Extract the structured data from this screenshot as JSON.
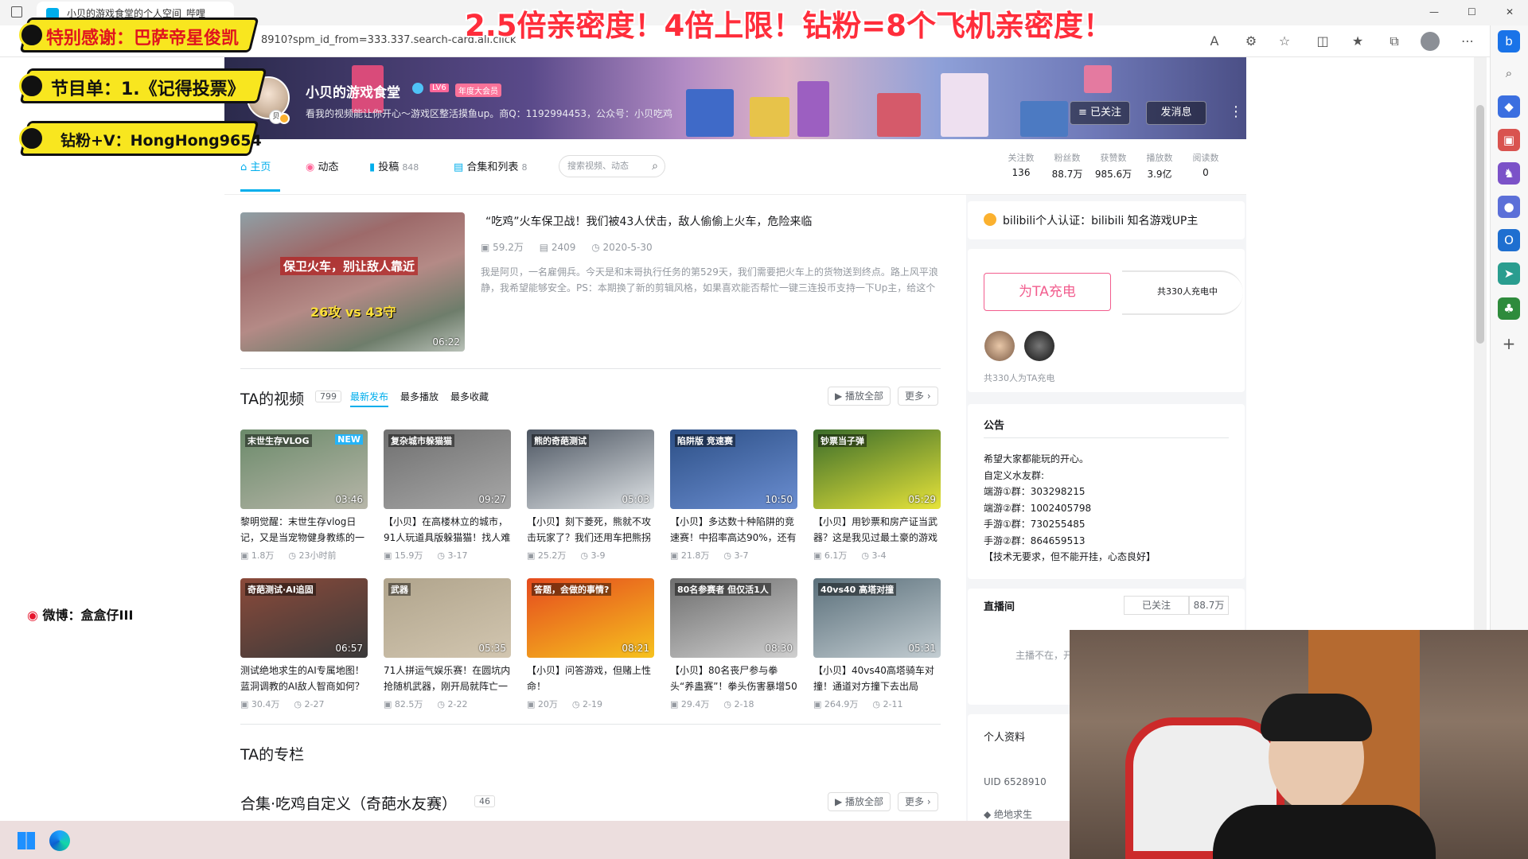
{
  "browser": {
    "tab_title": "小贝的游戏食堂的个人空间_哔哩",
    "url": "8910?spm_id_from=333.337.search-card.all.click",
    "reader_mode": "A",
    "window_min": "—",
    "window_max": "☐",
    "window_close": "✕"
  },
  "overlays": {
    "top_banner": "2.5倍亲密度！4倍上限！钻粉=8个飞机亲密度！",
    "thanks": "特别感谢：巴萨帝星俊凯",
    "playlist": "节目单：1.《记得投票》",
    "wechat": "钻粉+V：HongHong9654",
    "weibo": "微博：盒盒仔III"
  },
  "profile": {
    "name": "小贝的游戏食堂",
    "level": "LV6",
    "vip": "年度大会员",
    "sign": "看我的视频能让你开心～游戏区整活摸鱼up。商Q：1192994453，公众号：小贝吃鸡",
    "followed_label": "≡ 已关注",
    "message_label": "发消息",
    "avatar_badge": "贝"
  },
  "nav": {
    "home": "主页",
    "dynamic": "动态",
    "posts": "投稿",
    "posts_count": "848",
    "collections": "合集和列表",
    "collections_count": "8",
    "search_placeholder": "搜索视频、动态"
  },
  "stats": [
    {
      "label": "关注数",
      "value": "136"
    },
    {
      "label": "粉丝数",
      "value": "88.7万"
    },
    {
      "label": "获赞数",
      "value": "985.6万"
    },
    {
      "label": "播放数",
      "value": "3.9亿"
    },
    {
      "label": "阅读数",
      "value": "0"
    }
  ],
  "featured": {
    "title": "“吃鸡”火车保卫战！我们被43人伏击，敌人偷偷上火车，危险来临",
    "plays": "59.2万",
    "danmaku": "2409",
    "date": "2020-5-30",
    "desc": "我是阿贝，一名雇佣兵。今天是和末哥执行任务的第529天，我们需要把火车上的货物送到终点。路上风平浪静，我希望能够安全。PS：本期换了新的剪辑风格，如果喜欢能否帮忙一键三连投币支持一下Up主，给这个",
    "duration": "06:22",
    "thumb_line1": "保卫火车，别让敌人靠近",
    "thumb_line2": "26攻 vs 43守"
  },
  "videos_section": {
    "title": "TA的视频",
    "count": "799",
    "tab_latest": "最新发布",
    "tab_plays": "最多播放",
    "tab_fav": "最多收藏",
    "play_all": "▶ 播放全部",
    "more": "更多 ›"
  },
  "videos": [
    {
      "title": "黎明觉醒：末世生存vlog日记，又是当宠物健身教练的一",
      "plays": "1.8万",
      "time": "23小时前",
      "dur": "03:46",
      "thumb_text": "末世生存VLOG",
      "badge": "NEW"
    },
    {
      "title": "【小贝】在高楼林立的城市，91人玩道具版躲猫猫！找人难",
      "plays": "15.9万",
      "time": "3-17",
      "dur": "09:27",
      "thumb_text": "复杂城市躲猫猫"
    },
    {
      "title": "【小贝】刻下菱死，熊就不攻击玩家了？我们还用车把熊拐",
      "plays": "25.2万",
      "time": "3-9",
      "dur": "05:03",
      "thumb_text": "熊的奇葩测试"
    },
    {
      "title": "【小贝】多达数十种陷阱的竞速赛！中招率高达90%，还有",
      "plays": "21.8万",
      "time": "3-7",
      "dur": "10:50",
      "thumb_text": "陷阱版 竞速赛"
    },
    {
      "title": "【小贝】用钞票和房产证当武器？这是我见过最土豪的游戏",
      "plays": "6.1万",
      "time": "3-4",
      "dur": "05:29",
      "thumb_text": "钞票当子弹"
    },
    {
      "title": "测试绝地求生的AI专属地图！蓝洞调教的AI敌人智商如何？",
      "plays": "30.4万",
      "time": "2-27",
      "dur": "06:57",
      "thumb_text": "奇葩测试·AI追固"
    },
    {
      "title": "71人拼运气娱乐赛！在圆坑内抢随机武器，刚开局就阵亡一",
      "plays": "82.5万",
      "time": "2-22",
      "dur": "05:35",
      "thumb_text": "武器"
    },
    {
      "title": "【小贝】问答游戏，但赌上性命！",
      "plays": "20万",
      "time": "2-19",
      "dur": "08:21",
      "thumb_text": "答题，会做的事情?"
    },
    {
      "title": "【小贝】80名丧尸参与拳头“养蛊赛”！拳头伤害暴增50",
      "plays": "29.4万",
      "time": "2-18",
      "dur": "08:30",
      "thumb_text": "80名参赛者 但仅活1人"
    },
    {
      "title": "【小贝】40vs40高塔骑车对撞！通道对方撞下去出局",
      "plays": "264.9万",
      "time": "2-11",
      "dur": "05:31",
      "thumb_text": "40vs40 高塔对撞"
    }
  ],
  "column_section": {
    "title": "TA的专栏"
  },
  "collection_section": {
    "title": "合集·吃鸡自定义（奇葩水友赛）",
    "count": "46",
    "play_all": "▶ 播放全部",
    "more": "更多 ›"
  },
  "right": {
    "cert": "bilibili个人认证：bilibili 知名游戏UP主",
    "charge_btn": "为TA充电",
    "charge_total": "共330人充电中",
    "charge_count": "共330人为TA充电",
    "announce_title": "公告",
    "announce_lines": [
      "希望大家都能玩的开心。",
      "自定义水友群:",
      "端游①群：303298215",
      "端游②群：1002405798",
      "手游①群：730255485",
      "手游②群：864659513",
      "【技术无要求，但不能开挂，心态良好】"
    ],
    "live_title": "直播间",
    "live_followed": "已关注",
    "live_count": "88.7万",
    "live_offline": "主播不在，开",
    "profile_title": "个人资料",
    "uid": "UID  6528910",
    "tag": "绝地求生"
  },
  "colors": {
    "accent": "#00aeec",
    "pink": "#f25d8e",
    "overlay_yellow": "#f8e61f",
    "banner_red": "#ff2d3b"
  }
}
